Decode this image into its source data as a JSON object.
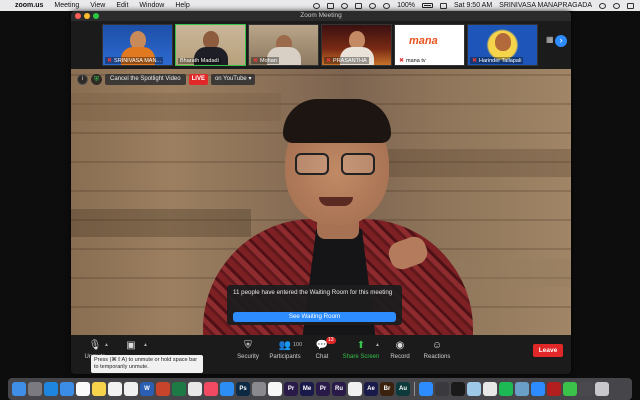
{
  "menubar": {
    "app": "zoom.us",
    "items": [
      "Meeting",
      "View",
      "Edit",
      "Window",
      "Help"
    ],
    "battery": "100%",
    "clock": "Sat 9:50 AM",
    "user": "SRINIVASA MANAPRAGADA"
  },
  "window": {
    "title": "Zoom Meeting"
  },
  "thumbnails": [
    {
      "name": "SRINIVASA MAN...",
      "muted": true
    },
    {
      "name": "Bharath Madadi",
      "muted": false
    },
    {
      "name": "Mohan",
      "muted": true
    },
    {
      "name": "PRASANTHA",
      "muted": true
    },
    {
      "name": "mana tv",
      "muted": true,
      "logo": "mana"
    },
    {
      "name": "Harinder Tallapali",
      "muted": true
    }
  ],
  "spotlight": {
    "cancel_label": "Cancel the Spotlight Video",
    "live_label": "LIVE",
    "platform_label": "on YouTube"
  },
  "waiting_room": {
    "message": "11 people have entered the Waiting Room for this meeting",
    "button": "See Waiting Room"
  },
  "controls": {
    "unmute": "Unmute",
    "unmute_tooltip": "Press (⌘⇧A) to unmute or hold space bar to temporarily unmute.",
    "security": "Security",
    "participants": "Participants",
    "participants_count": "100",
    "chat": "Chat",
    "chat_badge": "13",
    "share": "Share Screen",
    "record": "Record",
    "reactions": "Reactions",
    "leave": "Leave"
  },
  "dock": {
    "apps": [
      {
        "name": "finder-icon",
        "color": "#3f8ee8",
        "glyph": ""
      },
      {
        "name": "launchpad-icon",
        "color": "#7a7a80",
        "glyph": ""
      },
      {
        "name": "safari-icon",
        "color": "#1f86e0",
        "glyph": ""
      },
      {
        "name": "mail-icon",
        "color": "#3b8de6",
        "glyph": ""
      },
      {
        "name": "calendar-icon",
        "color": "#fafafa",
        "glyph": ""
      },
      {
        "name": "notes-icon",
        "color": "#f6d34a",
        "glyph": ""
      },
      {
        "name": "reminders-icon",
        "color": "#f2f2f2",
        "glyph": ""
      },
      {
        "name": "photos-icon",
        "color": "#f0f0f0",
        "glyph": ""
      },
      {
        "name": "word-icon",
        "color": "#2b5fb3",
        "glyph": "W"
      },
      {
        "name": "powerpoint-icon",
        "color": "#c8442a",
        "glyph": ""
      },
      {
        "name": "excel-icon",
        "color": "#1e7a45",
        "glyph": ""
      },
      {
        "name": "chrome-icon",
        "color": "#e8e8e8",
        "glyph": ""
      },
      {
        "name": "music-icon",
        "color": "#f24a62",
        "glyph": ""
      },
      {
        "name": "appstore-icon",
        "color": "#2c8ef5",
        "glyph": ""
      },
      {
        "name": "photoshop-icon",
        "color": "#0c2a44",
        "glyph": "Ps"
      },
      {
        "name": "settings-icon",
        "color": "#8a8a8e",
        "glyph": ""
      },
      {
        "name": "photos2-icon",
        "color": "#f7f7f7",
        "glyph": ""
      },
      {
        "name": "premiere-icon",
        "color": "#2a1a4a",
        "glyph": "Pr"
      },
      {
        "name": "media-encoder-icon",
        "color": "#1a1a4a",
        "glyph": "Me"
      },
      {
        "name": "premiere-rush-icon",
        "color": "#2a1a4a",
        "glyph": "Pr"
      },
      {
        "name": "premiere-rush-app-icon",
        "color": "#2a1a4a",
        "glyph": "Ru"
      },
      {
        "name": "zoom-tile-icon",
        "color": "#f0f0f0",
        "glyph": ""
      },
      {
        "name": "after-effects-icon",
        "color": "#1a1a4a",
        "glyph": "Ae"
      },
      {
        "name": "bridge-icon",
        "color": "#3a220e",
        "glyph": "Br"
      },
      {
        "name": "audition-icon",
        "color": "#0d3a3a",
        "glyph": "Au"
      },
      {
        "name": "zoom-icon",
        "color": "#2d8cff",
        "glyph": ""
      },
      {
        "name": "quicktime-icon",
        "color": "#3a3a3e",
        "glyph": ""
      },
      {
        "name": "terminal-icon",
        "color": "#1a1a1a",
        "glyph": ""
      },
      {
        "name": "preview-icon",
        "color": "#9ec8e8",
        "glyph": ""
      },
      {
        "name": "chrome2-icon",
        "color": "#e8e8e8",
        "glyph": ""
      },
      {
        "name": "spotify-icon",
        "color": "#1db954",
        "glyph": ""
      },
      {
        "name": "gallery-icon",
        "color": "#6aa0c8",
        "glyph": ""
      },
      {
        "name": "zoom2-icon",
        "color": "#2d8cff",
        "glyph": ""
      },
      {
        "name": "acrobat-icon",
        "color": "#b31e1e",
        "glyph": ""
      },
      {
        "name": "chat-icon",
        "color": "#3bc24a",
        "glyph": ""
      },
      {
        "name": "help-icon",
        "color": "#4a4a4e",
        "glyph": ""
      },
      {
        "name": "trash-icon",
        "color": "#c8c8cc",
        "glyph": ""
      }
    ]
  },
  "colors": {
    "accent_blue": "#2d8cff",
    "leave_red": "#e02828",
    "active_green": "#36c24a"
  }
}
